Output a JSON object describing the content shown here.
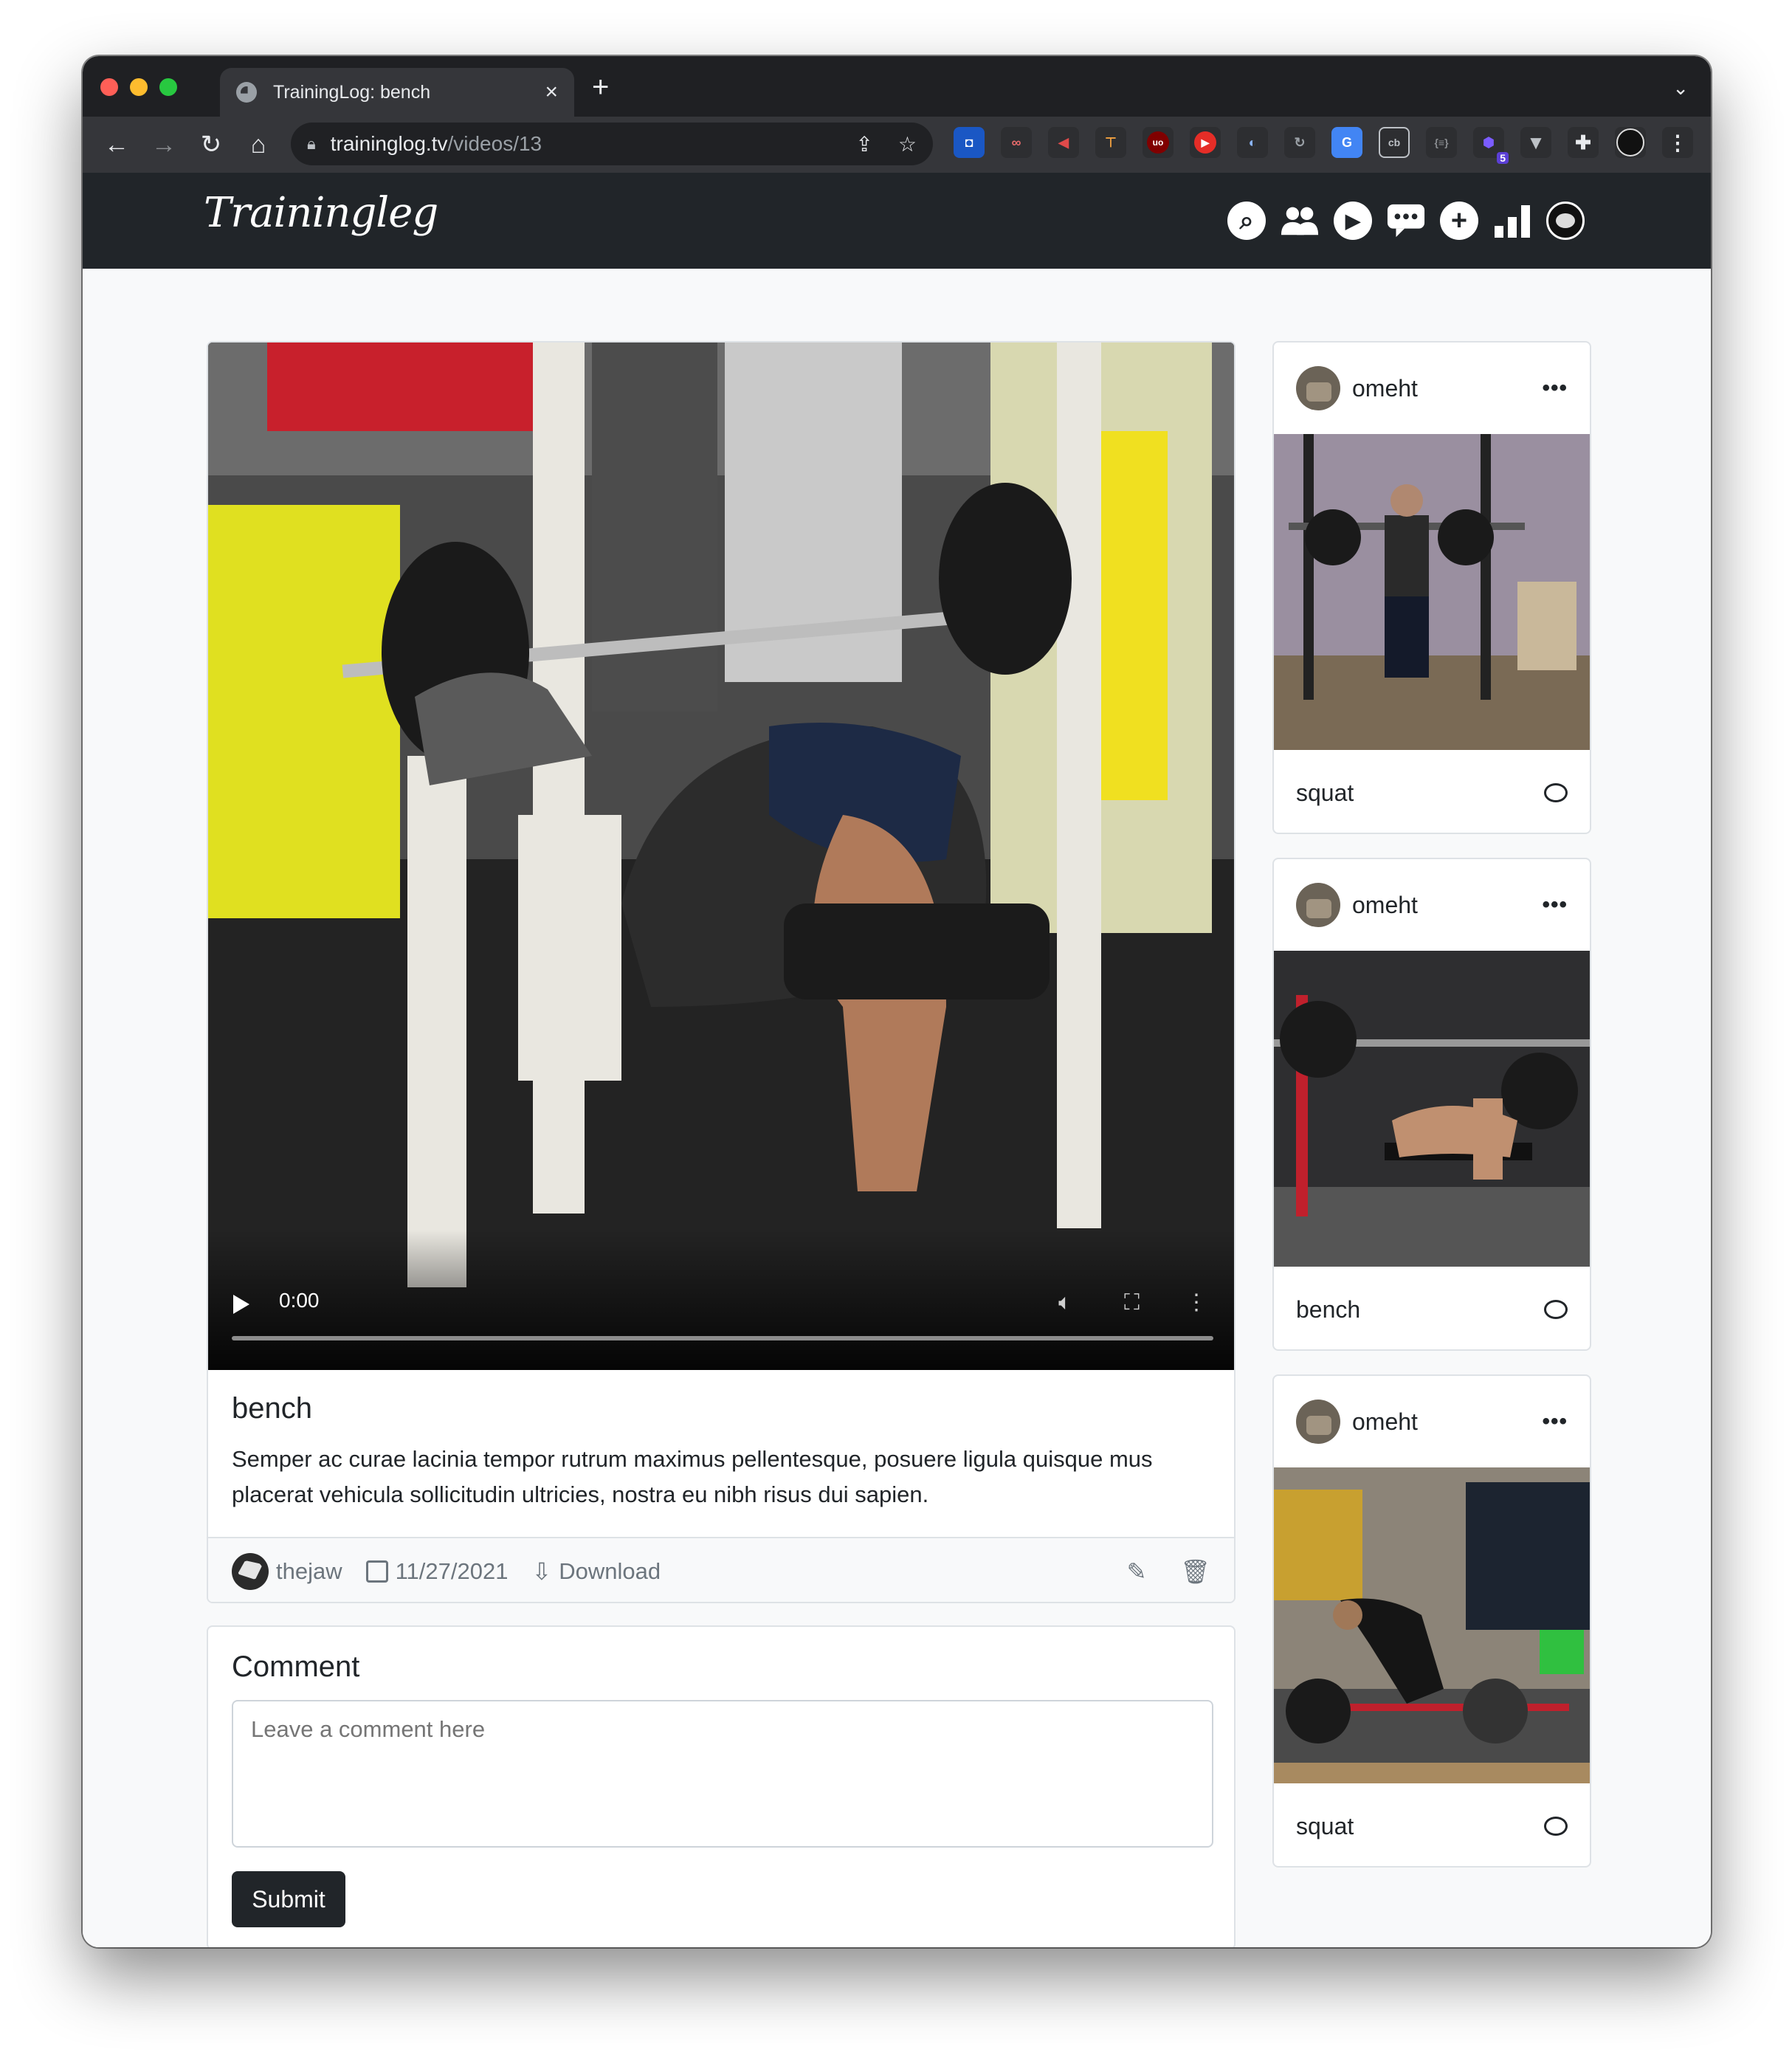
{
  "browser": {
    "tab_title": "TrainingLog: bench",
    "tab_close": "×",
    "new_tab": "+",
    "url_host": "traininglog.tv",
    "url_path": "/videos/13",
    "ext_badge": "5"
  },
  "site": {
    "brand": "Trainingleg",
    "nav_icons": [
      "search-icon",
      "users-icon",
      "play-icon",
      "chat-icon",
      "plus-icon",
      "chart-icon",
      "avatar"
    ]
  },
  "video": {
    "time": "0:00",
    "title": "bench",
    "description": "Semper ac curae lacinia tempor rutrum maximus pellentesque, posuere ligula quisque mus placerat vehicula sollicitudin ultricies, nostra eu nibh risus dui sapien.",
    "author": "thejaw",
    "date": "11/27/2021",
    "download_label": "Download"
  },
  "comment": {
    "heading": "Comment",
    "placeholder": "Leave a comment here",
    "submit_label": "Submit"
  },
  "sidebar": {
    "cards": [
      {
        "user": "omeht",
        "title": "squat"
      },
      {
        "user": "omeht",
        "title": "bench"
      },
      {
        "user": "omeht",
        "title": "squat"
      }
    ]
  },
  "colors": {
    "navbar": "#212529",
    "page_bg": "#f8f9fa",
    "button": "#212529"
  }
}
